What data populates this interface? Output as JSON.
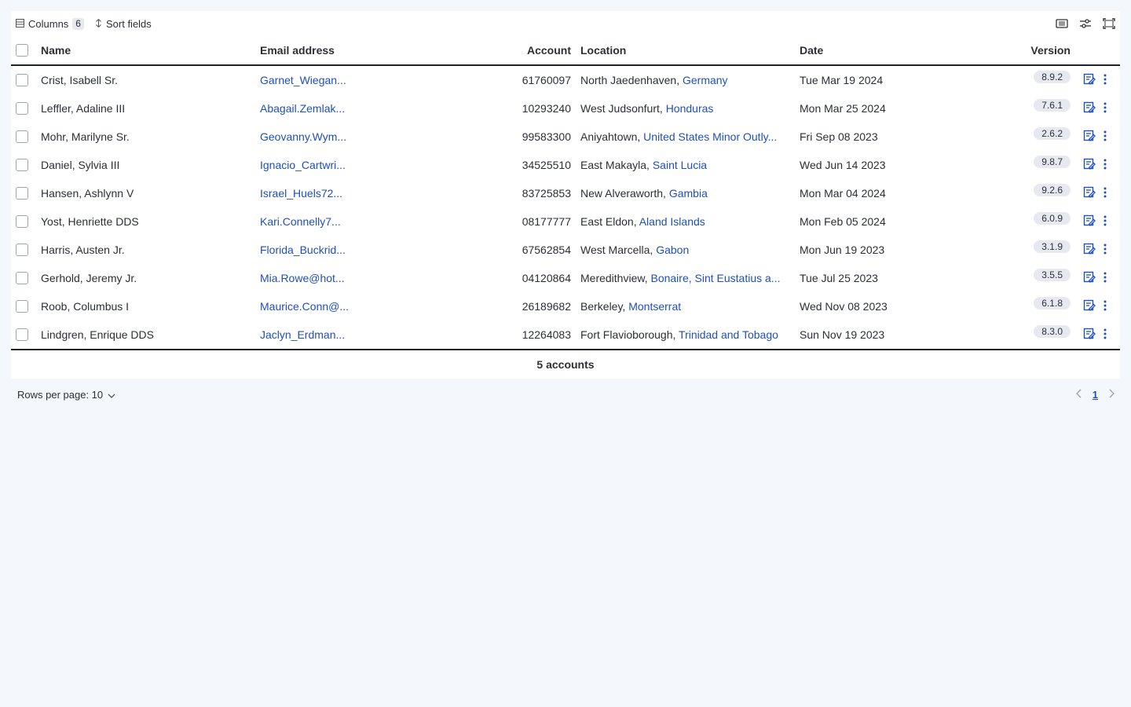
{
  "toolbar": {
    "columns_label": "Columns",
    "columns_count": "6",
    "sort_label": "Sort fields"
  },
  "headers": {
    "name": "Name",
    "email": "Email address",
    "account": "Account",
    "location": "Location",
    "date": "Date",
    "version": "Version"
  },
  "rows": [
    {
      "name": "Crist, Isabell Sr.",
      "email": "Garnet_Wiegan...",
      "account": "61760097",
      "city": "North Jaedenhaven, ",
      "country": "Germany",
      "date": "Tue Mar 19 2024",
      "version": "8.9.2"
    },
    {
      "name": "Leffler, Adaline III",
      "email": "Abagail.Zemlak...",
      "account": "10293240",
      "city": "West Judsonfurt, ",
      "country": "Honduras",
      "date": "Mon Mar 25 2024",
      "version": "7.6.1"
    },
    {
      "name": "Mohr, Marilyne Sr.",
      "email": "Geovanny.Wym...",
      "account": "99583300",
      "city": "Aniyahtown, ",
      "country": "United States Minor Outly...",
      "date": "Fri Sep 08 2023",
      "version": "2.6.2"
    },
    {
      "name": "Daniel, Sylvia III",
      "email": "Ignacio_Cartwri...",
      "account": "34525510",
      "city": "East Makayla, ",
      "country": "Saint Lucia",
      "date": "Wed Jun 14 2023",
      "version": "9.8.7"
    },
    {
      "name": "Hansen, Ashlynn V",
      "email": "Israel_Huels72...",
      "account": "83725853",
      "city": "New Alveraworth, ",
      "country": "Gambia",
      "date": "Mon Mar 04 2024",
      "version": "9.2.6"
    },
    {
      "name": "Yost, Henriette DDS",
      "email": "Kari.Connelly7...",
      "account": "08177777",
      "city": "East Eldon, ",
      "country": "Aland Islands",
      "date": "Mon Feb 05 2024",
      "version": "6.0.9"
    },
    {
      "name": "Harris, Austen Jr.",
      "email": "Florida_Buckrid...",
      "account": "67562854",
      "city": "West Marcella, ",
      "country": "Gabon",
      "date": "Mon Jun 19 2023",
      "version": "3.1.9"
    },
    {
      "name": "Gerhold, Jeremy Jr.",
      "email": "Mia.Rowe@hot...",
      "account": "04120864",
      "city": "Meredithview, ",
      "country": "Bonaire, Sint Eustatius a...",
      "date": "Tue Jul 25 2023",
      "version": "3.5.5"
    },
    {
      "name": "Roob, Columbus I",
      "email": "Maurice.Conn@...",
      "account": "26189682",
      "city": "Berkeley, ",
      "country": "Montserrat",
      "date": "Wed Nov 08 2023",
      "version": "6.1.8"
    },
    {
      "name": "Lindgren, Enrique DDS",
      "email": "Jaclyn_Erdman...",
      "account": "12264083",
      "city": "Fort Flavioborough, ",
      "country": "Trinidad and Tobago",
      "date": "Sun Nov 19 2023",
      "version": "8.3.0"
    }
  ],
  "footer": {
    "summary": "5 accounts"
  },
  "pagination": {
    "rows_per_page_label": "Rows per page: 10",
    "current_page": "1"
  },
  "icons": {
    "toolbar": [
      "columns-icon",
      "sort-icon",
      "density-icon",
      "filter-settings-icon",
      "fullscreen-icon"
    ],
    "row_actions": [
      "edit-icon",
      "more-vertical-icon"
    ]
  },
  "colors": {
    "link": "#1f4fb8",
    "background": "#f4f7fb",
    "badge": "#e6e9ef"
  }
}
